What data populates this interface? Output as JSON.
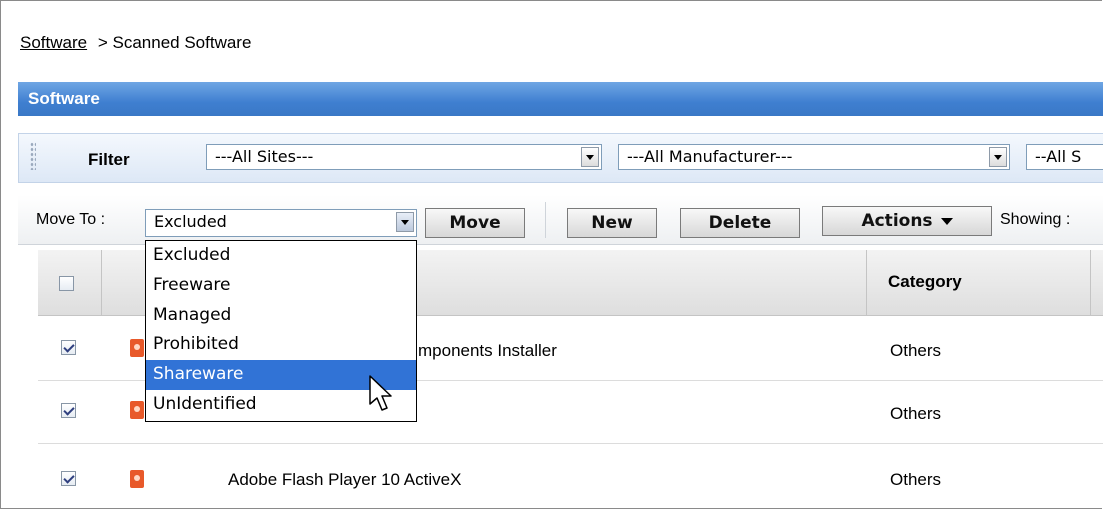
{
  "breadcrumb": {
    "link": "Software",
    "separator": ">",
    "current": "Scanned Software"
  },
  "panel": {
    "title": "Software"
  },
  "filter": {
    "label": "Filter",
    "sites": "---All Sites---",
    "manufacturer": "---All Manufacturer---",
    "third": "--All S"
  },
  "actions": {
    "move_to_label": "Move To :",
    "move_to_value": "Excluded",
    "move": "Move",
    "new": "New",
    "delete": "Delete",
    "actions": "Actions",
    "showing": "Showing :"
  },
  "table": {
    "headers": {
      "category": "Category"
    },
    "rows": [
      {
        "checked": true,
        "name": "mponents Installer",
        "category": "Others"
      },
      {
        "checked": true,
        "name": "",
        "category": "Others"
      },
      {
        "checked": true,
        "name": "Adobe Flash Player 10 ActiveX",
        "category": "Others"
      }
    ]
  },
  "move_to_options": [
    "Excluded",
    "Freeware",
    "Managed",
    "Prohibited",
    "Shareware",
    "UnIdentified"
  ],
  "move_to_highlighted": "Shareware",
  "colors": {
    "header_blue": "#3f7fd0",
    "highlight": "#3173d6",
    "icon": "#e8592a"
  }
}
